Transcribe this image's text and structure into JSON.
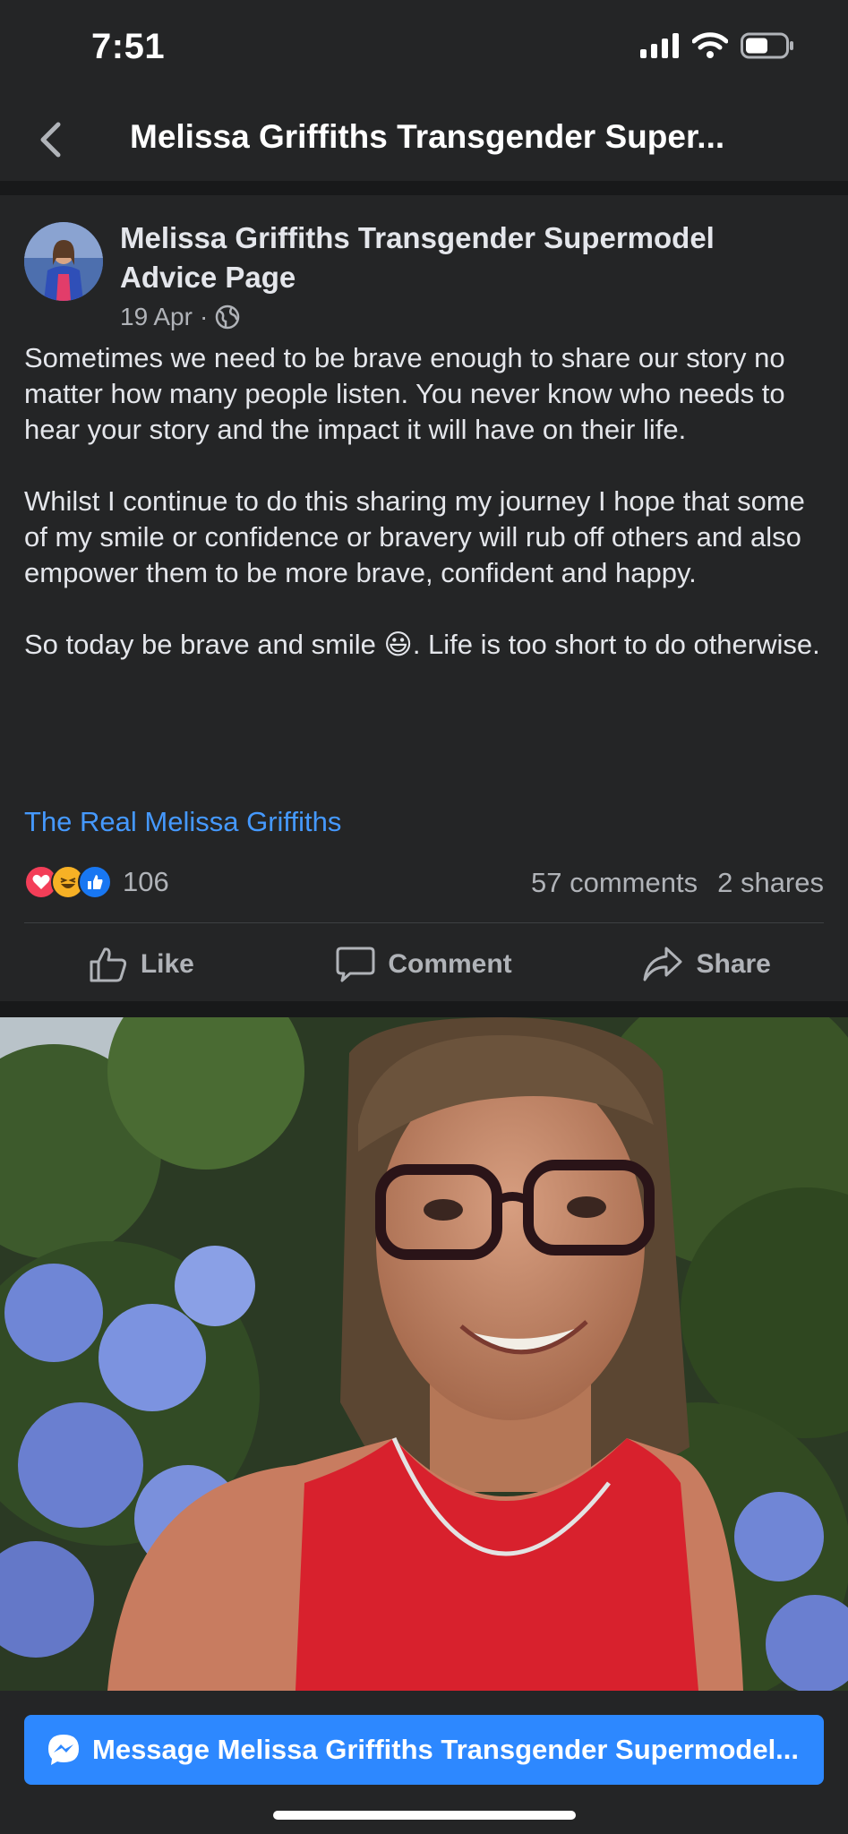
{
  "status": {
    "time": "7:51"
  },
  "nav": {
    "title": "Melissa Griffiths Transgender Super..."
  },
  "post": {
    "author": "Melissa Griffiths Transgender Supermodel Advice Page",
    "date": "19 Apr",
    "separator": "·",
    "paragraphs": [
      "Sometimes we need to be brave enough to share our story no matter how many people listen.  You never know who needs to hear your story and the impact it will have on their life.",
      "Whilst I continue to do this sharing my journey I hope that some of my smile or confidence or bravery will rub off others and also empower them to be more brave, confident and happy.",
      "So today be brave and smile 😃.  Life is too short to do otherwise."
    ],
    "link_text": "The Real Melissa Griffiths",
    "reaction_count": "106",
    "comments": "57 comments",
    "shares": "2 shares"
  },
  "actions": {
    "like": "Like",
    "comment": "Comment",
    "share": "Share"
  },
  "message_button": {
    "label": "Message Melissa Griffiths Transgender Supermodel..."
  },
  "colors": {
    "background": "#242526",
    "accent": "#2d88ff",
    "link": "#4599ff"
  }
}
